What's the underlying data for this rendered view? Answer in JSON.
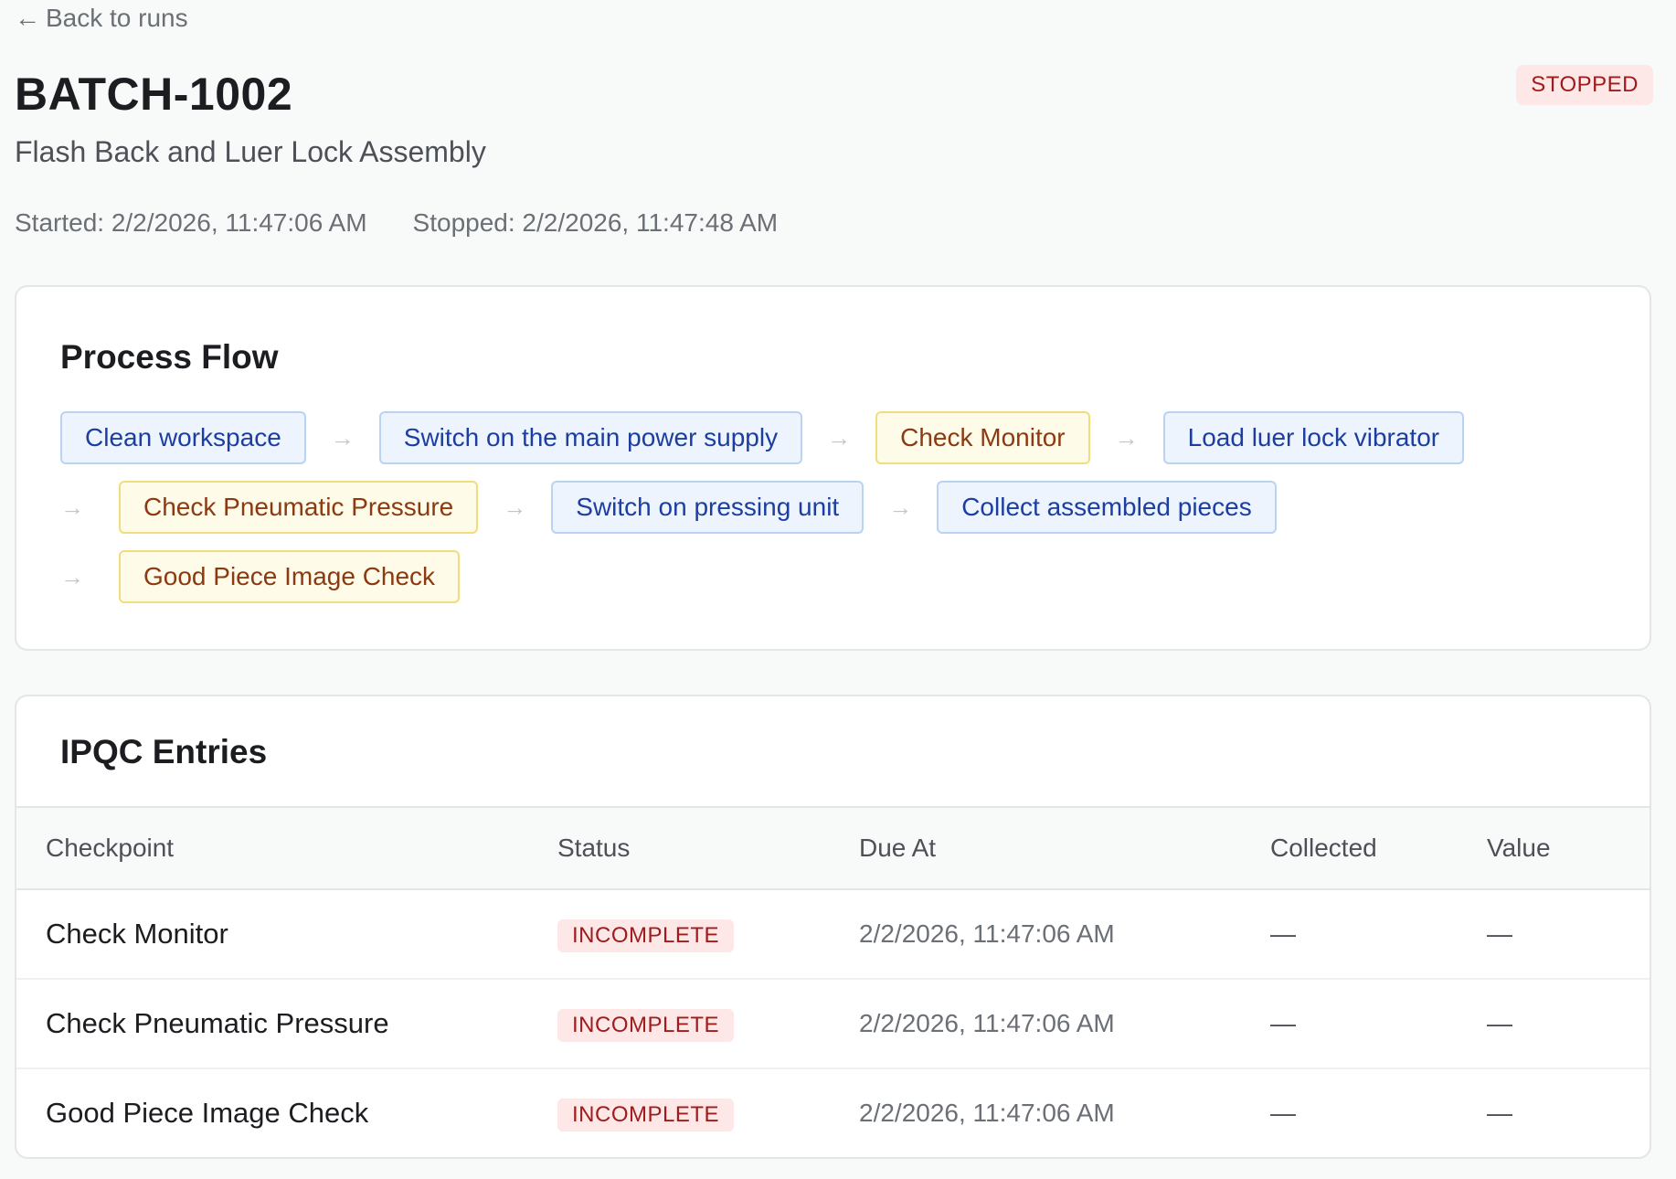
{
  "nav": {
    "back_arrow": "←",
    "back_label": "Back to runs"
  },
  "header": {
    "title": "BATCH-1002",
    "subtitle": "Flash Back and Luer Lock Assembly",
    "started": "Started: 2/2/2026, 11:47:06 AM",
    "stopped": "Stopped: 2/2/2026, 11:47:48 AM",
    "status": "STOPPED",
    "status_color": "#a01c1c"
  },
  "process_flow": {
    "title": "Process Flow",
    "arrow": "→",
    "steps": [
      {
        "label": "Clean workspace",
        "kind": "task"
      },
      {
        "label": "Switch on the main power supply",
        "kind": "task"
      },
      {
        "label": "Check Monitor",
        "kind": "check"
      },
      {
        "label": "Load luer lock vibrator",
        "kind": "task"
      },
      {
        "label": "Check Pneumatic Pressure",
        "kind": "check"
      },
      {
        "label": "Switch on pressing unit",
        "kind": "task"
      },
      {
        "label": "Collect assembled pieces",
        "kind": "task"
      },
      {
        "label": "Good Piece Image Check",
        "kind": "check"
      }
    ],
    "colors": {
      "task_bg": "#edf4fd",
      "task_text": "#1c3ea0",
      "check_bg": "#fefbe9",
      "check_text": "#8b3a12"
    }
  },
  "ipqc": {
    "title": "IPQC Entries",
    "columns": [
      "Checkpoint",
      "Status",
      "Due At",
      "Collected",
      "Value"
    ],
    "rows": [
      {
        "checkpoint": "Check Monitor",
        "status": "INCOMPLETE",
        "due_at": "2/2/2026, 11:47:06 AM",
        "collected": "—",
        "value": "—"
      },
      {
        "checkpoint": "Check Pneumatic Pressure",
        "status": "INCOMPLETE",
        "due_at": "2/2/2026, 11:47:06 AM",
        "collected": "—",
        "value": "—"
      },
      {
        "checkpoint": "Good Piece Image Check",
        "status": "INCOMPLETE",
        "due_at": "2/2/2026, 11:47:06 AM",
        "collected": "—",
        "value": "—"
      }
    ]
  }
}
